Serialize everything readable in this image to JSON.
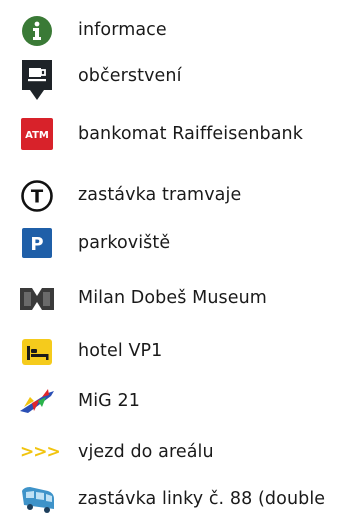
{
  "legend": {
    "items": [
      {
        "icon": "info-icon",
        "label": "informace",
        "color": "#3a7a36"
      },
      {
        "icon": "coffee-cup-marker-icon",
        "label": "občerstvení",
        "color": "#1e2328"
      },
      {
        "icon": "atm-icon",
        "label": "bankomat Raiffeisenbank",
        "icon_text": "ATM",
        "color": "#d8222a"
      },
      {
        "icon": "tram-stop-icon",
        "label": "zastávka tramvaje",
        "icon_text": "T",
        "color": "#111111"
      },
      {
        "icon": "parking-icon",
        "label": "parkoviště",
        "icon_text": "P",
        "color": "#1f5fa8"
      },
      {
        "icon": "museum-icon",
        "label": "Milan Dobeš Museum",
        "color": "#3a3a3a"
      },
      {
        "icon": "hotel-bed-icon",
        "label": "hotel VP1",
        "color": "#f5cb1c"
      },
      {
        "icon": "jet-plane-icon",
        "label": "MiG 21",
        "color": "#2a4fb5"
      },
      {
        "icon": "entrance-chevrons-icon",
        "label": "vjezd do areálu",
        "icon_text": ">>>",
        "color": "#f1c40f"
      },
      {
        "icon": "bus-icon",
        "label": "zastávka linky č. 88 (double",
        "color": "#3e93c9"
      }
    ]
  }
}
